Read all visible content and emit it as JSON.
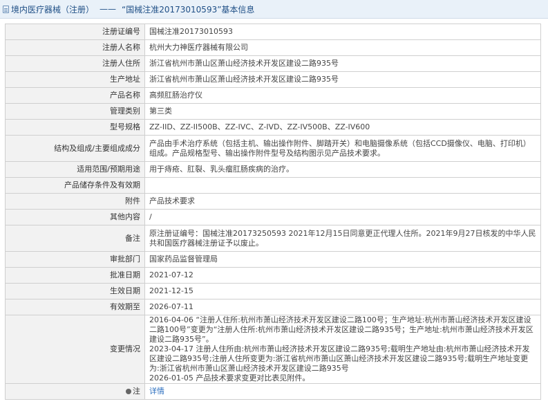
{
  "header": {
    "crumb": "境内医疗器械（注册）",
    "separator": "——",
    "record_title": "“国械注准20173010593”基本信息"
  },
  "rows": [
    {
      "label": "注册证编号",
      "value": "国械注准20173010593"
    },
    {
      "label": "注册人名称",
      "value": "杭州大力神医疗器械有限公司"
    },
    {
      "label": "注册人住所",
      "value": "浙江省杭州市萧山区萧山经济技术开发区建设二路935号"
    },
    {
      "label": "生产地址",
      "value": "浙江省杭州市萧山区萧山经济技术开发区建设二路935号"
    },
    {
      "label": "产品名称",
      "value": "高频肛肠治疗仪"
    },
    {
      "label": "管理类别",
      "value": "第三类"
    },
    {
      "label": "型号规格",
      "value": "ZZ-IID、ZZ-II500B、ZZ-IVC、Z-IVD、ZZ-IV500B、ZZ-IV600"
    },
    {
      "label": "结构及组成/主要组成成分",
      "value": "产品由手术治疗系统（包括主机、输出操作附件、脚踏开关）和电脑摄像系统（包括CCD摄像仪、电脑、打印机）组成。产品规格型号、输出操作附件型号及结构图示见产品技术要求。"
    },
    {
      "label": "适用范围/预期用途",
      "value": "用于痔疮、肛裂、乳头瘤肛肠疾病的治疗。"
    },
    {
      "label": "产品储存条件及有效期",
      "value": ""
    },
    {
      "label": "附件",
      "value": "产品技术要求"
    },
    {
      "label": "其他内容",
      "value": "/"
    },
    {
      "label": "备注",
      "value": "原注册证编号：国械注准20173250593 2021年12月15日同意更正代理人住所。2021年9月27日核发的中华人民共和国医疗器械注册证予以废止。"
    },
    {
      "label": "审批部门",
      "value": "国家药品监督管理局"
    },
    {
      "label": "批准日期",
      "value": "2021-07-12"
    },
    {
      "label": "生效日期",
      "value": "2021-12-15"
    },
    {
      "label": "有效期至",
      "value": "2026-07-11"
    }
  ],
  "changes": {
    "label": "变更情况",
    "lines": [
      "2016-04-06 “注册人住所:杭州市萧山经济技术开发区建设二路100号；生产地址:杭州市萧山经济技术开发区建设二路100号”变更为“注册人住所:杭州市萧山经济技术开发区建设二路935号；生产地址:杭州市萧山经济技术开发区建设二路935号”。",
      "2023-04-17 注册人住所由:杭州市萧山经济技术开发区建设二路935号;载明生产地址由:杭州市萧山经济技术开发区建设二路935号;注册人住所变更为:浙江省杭州市萧山区萧山经济技术开发区建设二路935号;载明生产地址变更为:浙江省杭州市萧山区萧山经济技术开发区建设二路935号",
      "2026-01-05 产品技术要求变更对比表见附件。"
    ]
  },
  "note": {
    "label": "注",
    "link": "详情"
  }
}
